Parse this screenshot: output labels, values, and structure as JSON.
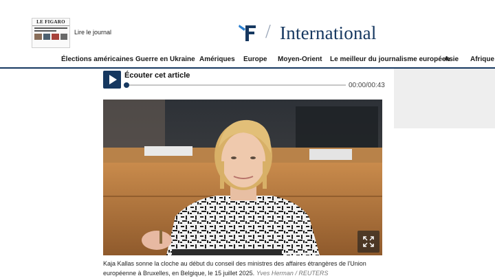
{
  "header": {
    "journal_link": "Lire le journal",
    "thumbnail_masthead": "LE FIGARO",
    "section_title": "International",
    "separator": "/"
  },
  "nav": {
    "items": [
      "Élections américaines",
      "Guerre en Ukraine",
      "Amériques",
      "Europe",
      "Moyen-Orient",
      "Le meilleur du journalisme européen",
      "Asie",
      "Afrique"
    ]
  },
  "audio": {
    "title": "Écouter cet article",
    "time": "00:00/00:43",
    "progress": 0
  },
  "photo": {
    "caption": "Kaja Kallas sonne la cloche au début du conseil des ministres des affaires étrangères de l'Union européenne à Bruxelles, en Belgique, le 15 juillet 2025.",
    "credit": "Yves Herman / REUTERS"
  },
  "colors": {
    "brand_navy": "#163860",
    "nav_rule": "#163860",
    "side_block": "#eeeeee"
  },
  "icons": {
    "logo": "figaro-f-logo-icon",
    "play": "play-icon",
    "expand": "expand-icon"
  }
}
